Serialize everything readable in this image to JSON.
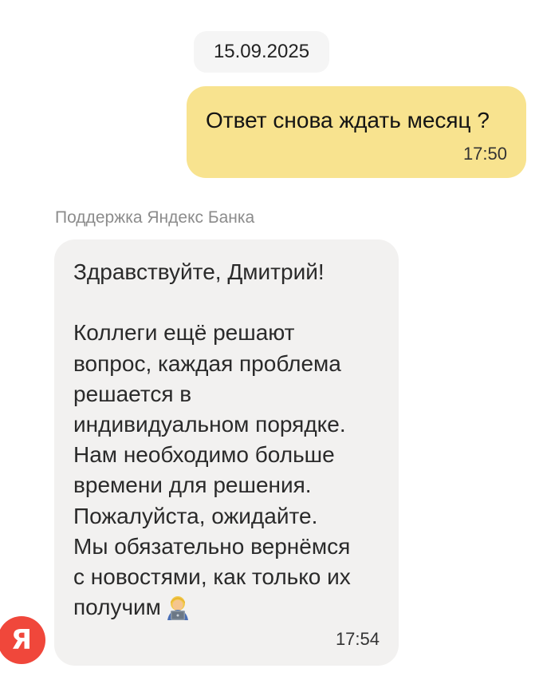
{
  "date_chip": "15.09.2025",
  "outgoing_message": {
    "text": "Ответ снова ждать месяц ?",
    "time": "17:50"
  },
  "incoming_message": {
    "sender": "Поддержка Яндекс Банка",
    "lines": [
      "Здравствуйте, Дмитрий!",
      "",
      "Коллеги ещё решают",
      "вопрос, каждая проблема",
      "решается в",
      "индивидуальном порядке.",
      "Нам необходимо больше",
      "времени для решения.",
      "Пожалуйста, ожидайте.",
      "Мы обязательно вернёмся",
      "с новостями, как только их",
      "получим"
    ],
    "emoji_icon": "person-with-laptop-icon",
    "time": "17:54"
  },
  "avatar": {
    "letter": "Я",
    "color": "#f0473b"
  },
  "colors": {
    "outgoing_bubble": "#f8e38f",
    "incoming_bubble": "#f2f1f0",
    "date_chip": "#f5f5f5"
  }
}
